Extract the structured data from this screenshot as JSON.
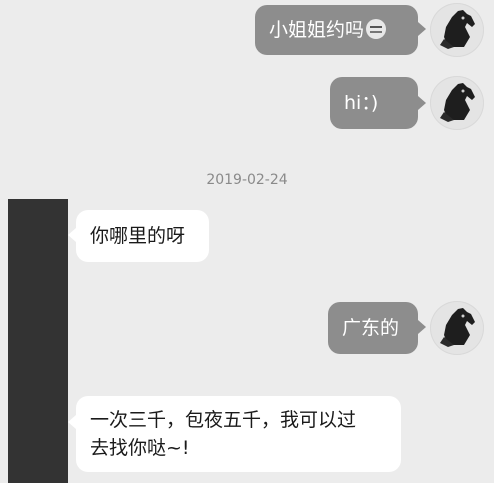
{
  "timestamp": "2019-02-24",
  "messages": [
    {
      "side": "sent",
      "text": "小姐姐约吗",
      "emoji": "dizzy-face-emoji"
    },
    {
      "side": "sent",
      "text": "hi：)"
    },
    {
      "side": "received",
      "text": "你哪里的呀"
    },
    {
      "side": "sent",
      "text": "广东的"
    },
    {
      "side": "received",
      "line1": "一次三千，包夜五千，我可以过",
      "line2": "去找你哒~!"
    }
  ],
  "colors": {
    "background": "#ececec",
    "sent_bubble": "#8d8d8d",
    "received_bubble": "#ffffff",
    "redaction": "#333333"
  },
  "icons": {
    "user_avatar": "horse-head-avatar-icon"
  }
}
